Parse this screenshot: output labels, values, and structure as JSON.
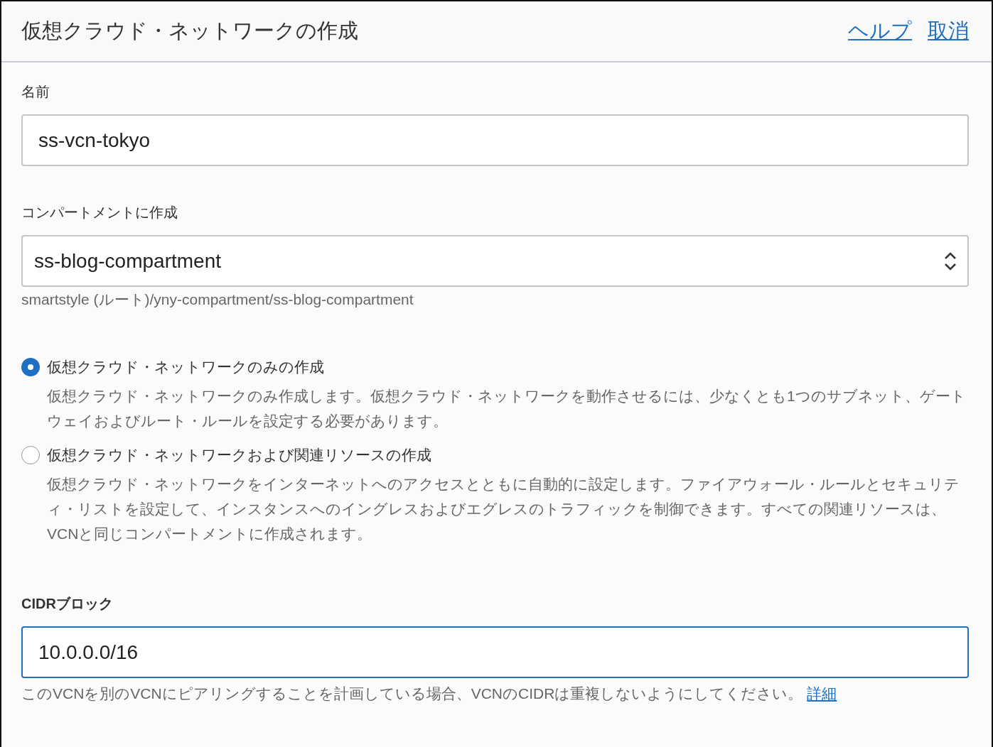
{
  "header": {
    "title": "仮想クラウド・ネットワークの作成",
    "links": [
      "ヘルプ",
      "取消"
    ]
  },
  "name_field": {
    "label": "名前",
    "value": "ss-vcn-tokyo"
  },
  "compartment_field": {
    "label": "コンパートメントに作成",
    "value": "ss-blog-compartment",
    "path": "smartstyle (ルート)/yny-compartment/ss-blog-compartment"
  },
  "options": [
    {
      "label": "仮想クラウド・ネットワークのみの作成",
      "description": "仮想クラウド・ネットワークのみ作成します。仮想クラウド・ネットワークを動作させるには、少なくとも1つのサブネット、ゲートウェイおよびルート・ルールを設定する必要があります。",
      "selected": true
    },
    {
      "label": "仮想クラウド・ネットワークおよび関連リソースの作成",
      "description": "仮想クラウド・ネットワークをインターネットへのアクセスとともに自動的に設定します。ファイアウォール・ルールとセキュリティ・リストを設定して、インスタンスへのイングレスおよびエグレスのトラフィックを制御できます。すべての関連リソースは、VCNと同じコンパートメントに作成されます。",
      "selected": false
    }
  ],
  "cidr_field": {
    "label": "CIDRブロック",
    "value": "10.0.0.0/16",
    "focused": true,
    "help": "このVCNを別のVCNにピアリングすることを計画している場合、VCNのCIDRは重複しないようにしてください。",
    "help_link": "詳細"
  }
}
